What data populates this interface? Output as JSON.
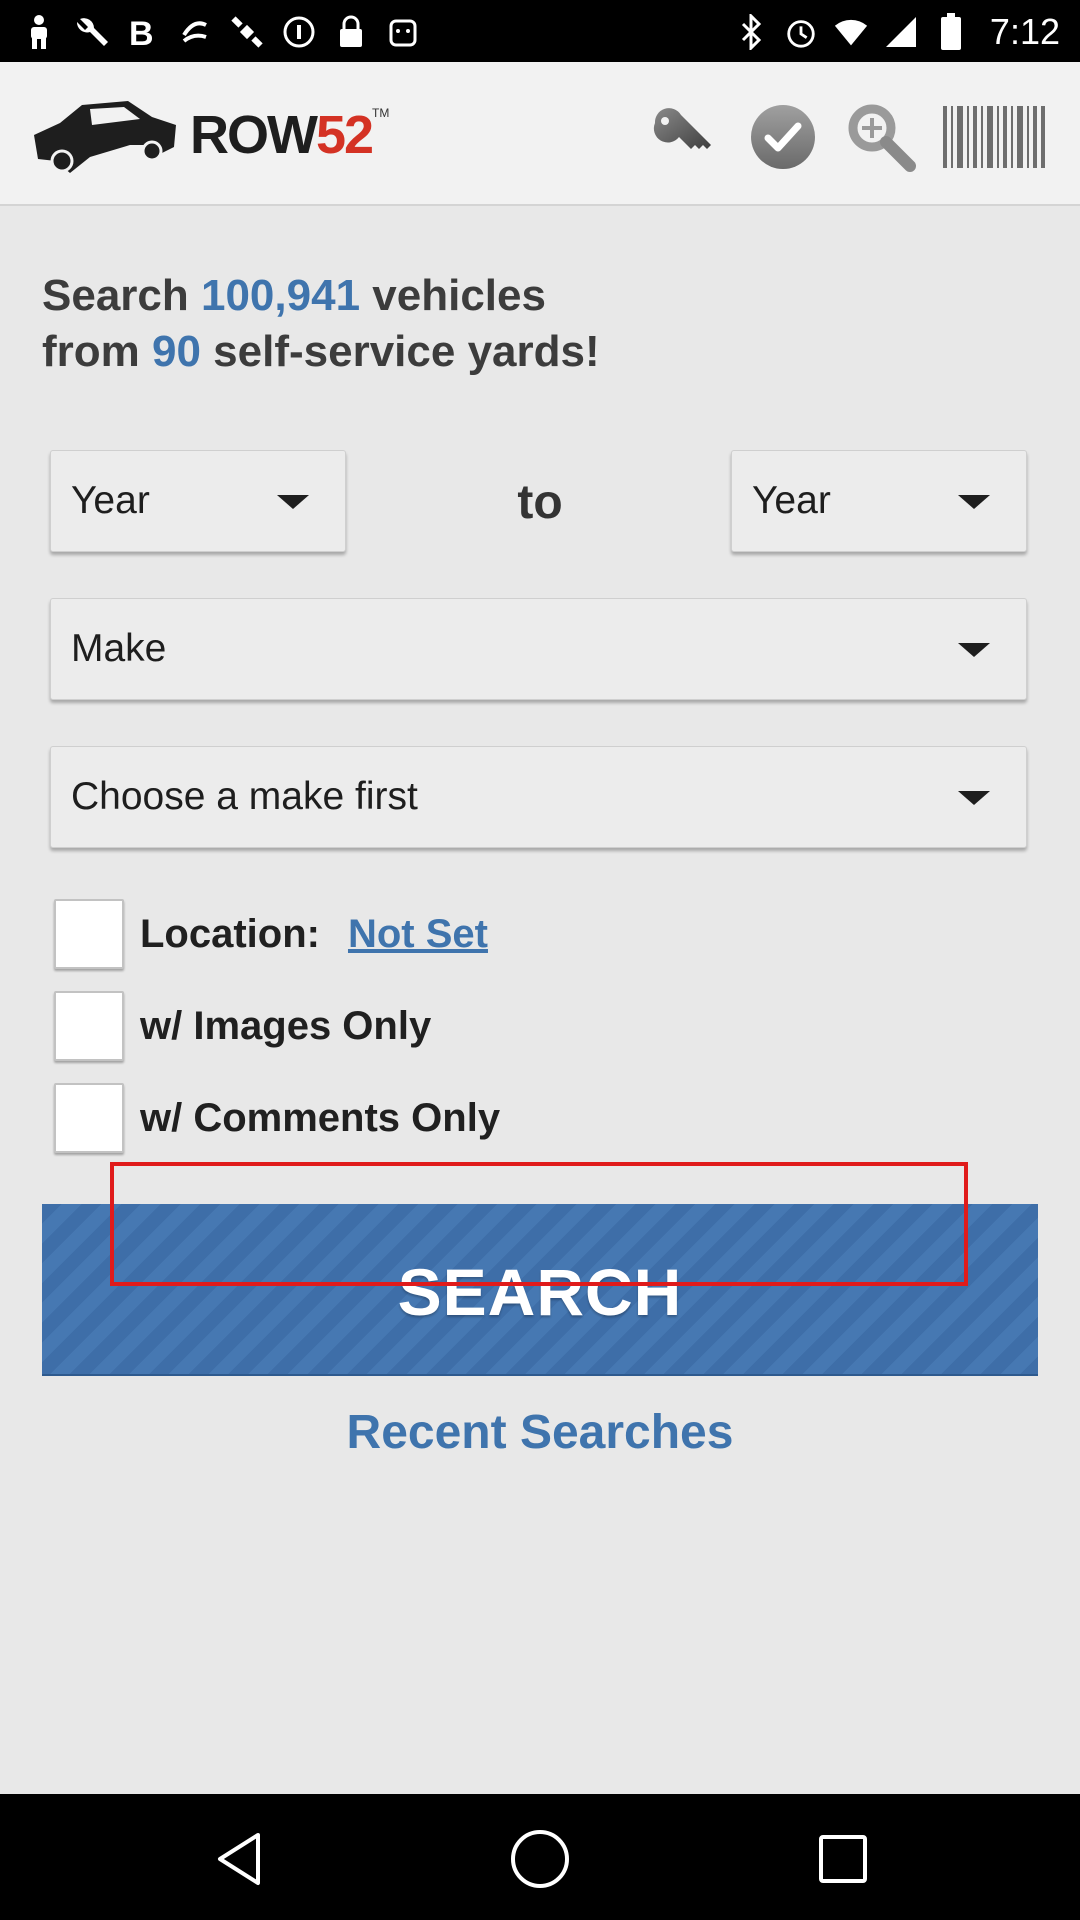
{
  "status_bar": {
    "time": "7:12",
    "left_icons": [
      "person-icon",
      "wrench-icon",
      "bold-b-icon",
      "swipe-icon",
      "satellite-icon",
      "info-circle-icon",
      "lock-icon",
      "android-icon"
    ],
    "right_icons": [
      "bluetooth-icon",
      "alarm-icon",
      "wifi-icon",
      "signal-icon",
      "battery-icon"
    ]
  },
  "header": {
    "logo_word": "ROW",
    "logo_number": "52",
    "logo_tm": "TM",
    "toolbar_icons": [
      "key-icon",
      "check-icon",
      "magnifier-icon",
      "barcode-icon"
    ]
  },
  "headline": {
    "line1_prefix": "Search ",
    "vehicle_count": "100,941",
    "line1_suffix": " vehicles",
    "line2_prefix": "from ",
    "yard_count": "90",
    "line2_suffix": " self-service yards!"
  },
  "filters": {
    "year_from": "Year",
    "to_label": "to",
    "year_to": "Year",
    "make": "Make",
    "model": "Choose a make first"
  },
  "options": {
    "location_label": "Location:",
    "location_value": "Not Set",
    "images_label": "w/ Images Only",
    "comments_label": "w/ Comments Only"
  },
  "actions": {
    "search_label": "SEARCH",
    "recent_label": "Recent Searches"
  },
  "colors": {
    "accent_blue": "#3f74ad",
    "button_blue": "#3e6ea8",
    "highlight_red": "#e01b1b",
    "logo_red": "#d43224"
  }
}
